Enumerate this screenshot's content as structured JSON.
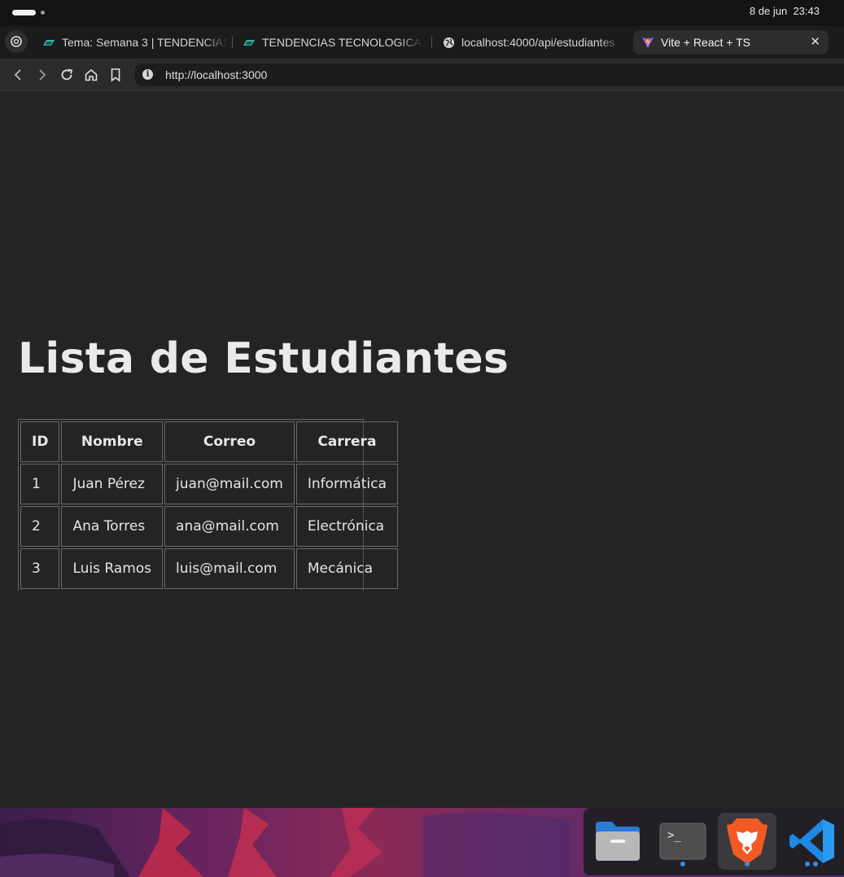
{
  "system": {
    "date": "8 de jun",
    "time": "23:43"
  },
  "tabs": [
    {
      "label": "Tema: Semana 3 | TENDENCIAS",
      "icon": "moodle-icon"
    },
    {
      "label": "TENDENCIAS TECNOLOGICAS",
      "icon": "moodle-icon"
    },
    {
      "label": "localhost:4000/api/estudiantes",
      "icon": "globe-icon"
    },
    {
      "label": "Vite + React + TS",
      "icon": "vite-icon",
      "active": true
    }
  ],
  "address": {
    "url": "http://localhost:3000"
  },
  "page": {
    "title": "Lista de Estudiantes",
    "table": {
      "headers": [
        "ID",
        "Nombre",
        "Correo",
        "Carrera"
      ],
      "rows": [
        [
          "1",
          "Juan Pérez",
          "juan@mail.com",
          "Informática"
        ],
        [
          "2",
          "Ana Torres",
          "ana@mail.com",
          "Electrónica"
        ],
        [
          "3",
          "Luis Ramos",
          "luis@mail.com",
          "Mecánica"
        ]
      ]
    }
  },
  "dock": [
    {
      "name": "files-icon"
    },
    {
      "name": "terminal-icon",
      "label": ">_"
    },
    {
      "name": "brave-browser-icon"
    },
    {
      "name": "vscode-icon"
    }
  ],
  "colors": {
    "page_bg": "#242424",
    "accent_dot": "#3a8dde",
    "brave_orange": "#f25a24",
    "vscode_blue": "#1e88e5"
  }
}
